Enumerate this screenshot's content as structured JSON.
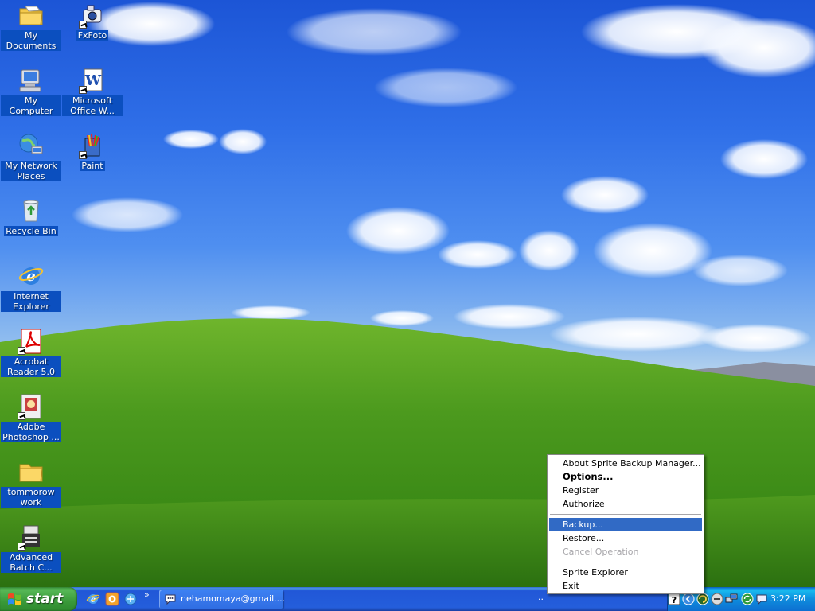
{
  "desktop": {
    "icons": [
      {
        "label": "My Documents"
      },
      {
        "label": "FxFoto"
      },
      {
        "label": "My Computer"
      },
      {
        "label": "Microsoft Office W..."
      },
      {
        "label": "My Network Places"
      },
      {
        "label": "Paint"
      },
      {
        "label": "Recycle Bin"
      },
      {
        "label": "Internet Explorer"
      },
      {
        "label": "Acrobat Reader 5.0"
      },
      {
        "label": "Adobe Photoshop ..."
      },
      {
        "label": "tommorow work"
      },
      {
        "label": "Advanced Batch C..."
      }
    ]
  },
  "context_menu": {
    "items": [
      {
        "label": "About Sprite Backup Manager...",
        "state": "normal"
      },
      {
        "label": "Options...",
        "state": "default"
      },
      {
        "label": "Register",
        "state": "normal"
      },
      {
        "label": "Authorize",
        "state": "normal"
      },
      {
        "label": "Backup...",
        "state": "highlighted"
      },
      {
        "label": "Restore...",
        "state": "normal"
      },
      {
        "label": "Cancel Operation",
        "state": "disabled"
      },
      {
        "label": "Sprite Explorer",
        "state": "normal"
      },
      {
        "label": "Exit",
        "state": "normal"
      }
    ]
  },
  "taskbar": {
    "start_label": "start",
    "quick_launch_more": "»",
    "task_item_label": "nehamomaya@gmail....",
    "more": "..",
    "clock": "3:22 PM"
  },
  "colors": {
    "taskbar_blue": "#245edb",
    "start_green": "#3a9a3a",
    "tray_blue": "#0f8ddd",
    "menu_highlight": "#316ac5",
    "icon_label_bg": "#0b4fbf"
  }
}
